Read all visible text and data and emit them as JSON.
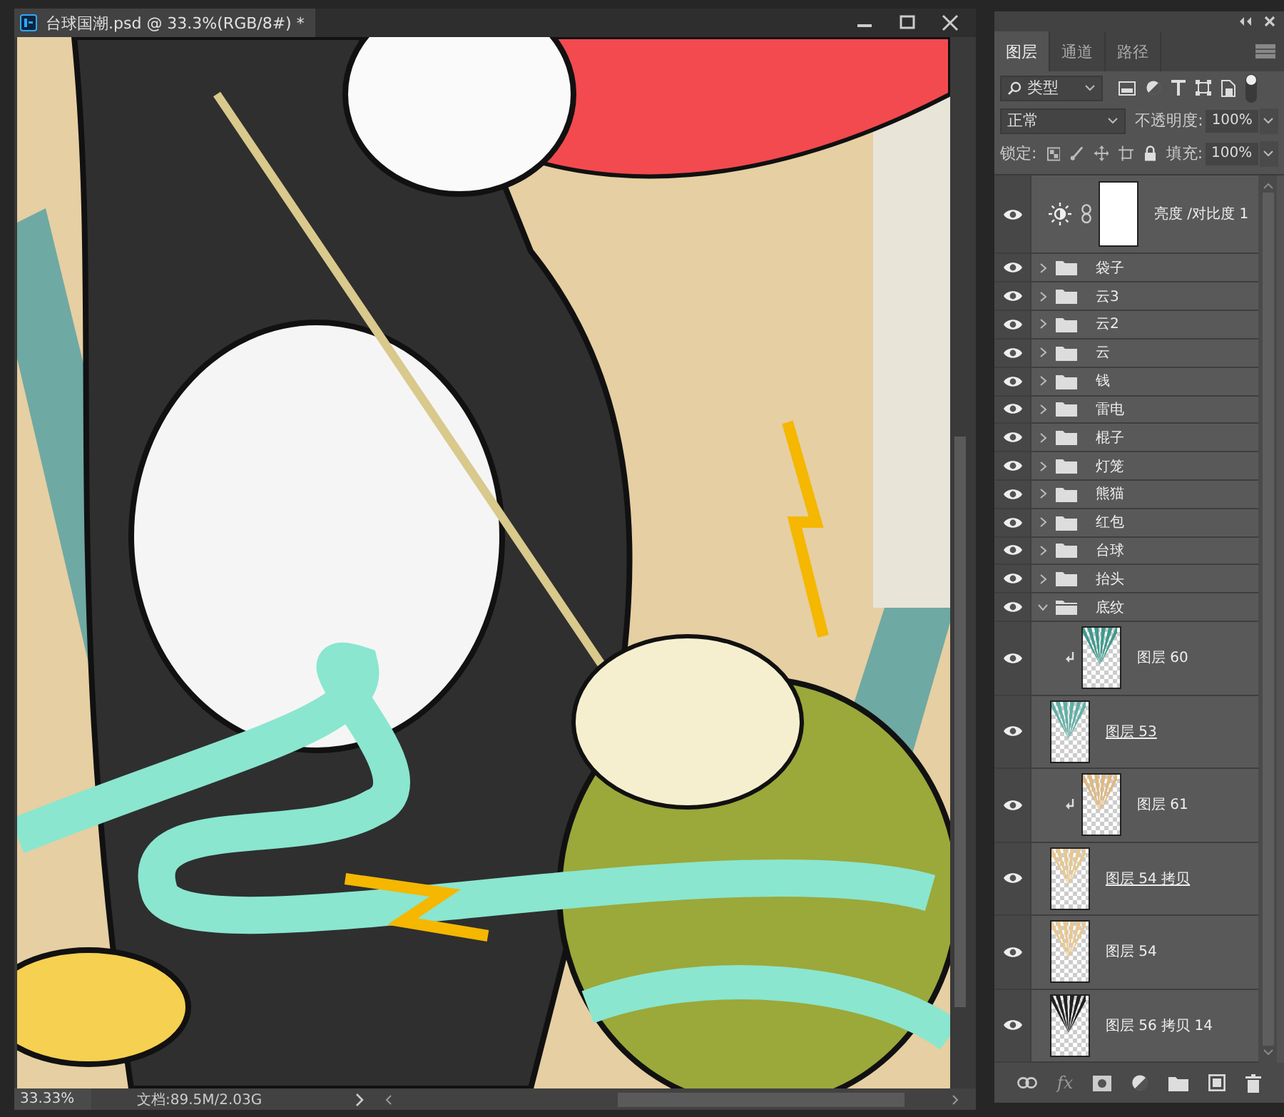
{
  "document": {
    "title": "台球国潮.psd @ 33.3%(RGB/8#) *",
    "zoom": "33.33%",
    "doc_info": "文档:89.5M/2.03G"
  },
  "layers_panel": {
    "tabs": [
      {
        "label": "图层",
        "selected": true
      },
      {
        "label": "通道",
        "selected": false
      },
      {
        "label": "路径",
        "selected": false
      }
    ],
    "filter": {
      "value": "类型"
    },
    "blend_mode": {
      "value": "正常"
    },
    "opacity": {
      "label": "不透明度:",
      "value": "100%"
    },
    "lock_label": "锁定:",
    "fill": {
      "label": "填充:",
      "value": "100%"
    },
    "layers": [
      {
        "kind": "adjustment",
        "name": "亮度 /对比度 1",
        "visible": true
      },
      {
        "kind": "group",
        "name": "袋子",
        "visible": true,
        "expanded": false
      },
      {
        "kind": "group",
        "name": "云3",
        "visible": true,
        "expanded": false
      },
      {
        "kind": "group",
        "name": "云2",
        "visible": true,
        "expanded": false
      },
      {
        "kind": "group",
        "name": "云",
        "visible": true,
        "expanded": false
      },
      {
        "kind": "group",
        "name": "钱",
        "visible": true,
        "expanded": false
      },
      {
        "kind": "group",
        "name": "雷电",
        "visible": true,
        "expanded": false
      },
      {
        "kind": "group",
        "name": "棍子",
        "visible": true,
        "expanded": false
      },
      {
        "kind": "group",
        "name": "灯笼",
        "visible": true,
        "expanded": false
      },
      {
        "kind": "group",
        "name": "熊猫",
        "visible": true,
        "expanded": false
      },
      {
        "kind": "group",
        "name": "红包",
        "visible": true,
        "expanded": false
      },
      {
        "kind": "group",
        "name": "台球",
        "visible": true,
        "expanded": false
      },
      {
        "kind": "group",
        "name": "抬头",
        "visible": true,
        "expanded": false
      },
      {
        "kind": "group",
        "name": "底纹",
        "visible": true,
        "expanded": true,
        "children": [
          {
            "kind": "pixel",
            "name": "图层 60",
            "visible": true,
            "clipped": true,
            "clip_base": false,
            "color": "#3f9a8c"
          },
          {
            "kind": "pixel",
            "name": "图层 53",
            "visible": true,
            "clipped": false,
            "clip_base": true,
            "color": "#5fb0a6"
          },
          {
            "kind": "pixel",
            "name": "图层 61",
            "visible": true,
            "clipped": true,
            "clip_base": false,
            "color": "#e0b880"
          },
          {
            "kind": "pixel",
            "name": "图层 54 拷贝",
            "visible": true,
            "clipped": false,
            "clip_base": true,
            "color": "#e8c890"
          },
          {
            "kind": "pixel",
            "name": "图层 54",
            "visible": true,
            "clipped": false,
            "clip_base": false,
            "color": "#e8c890"
          },
          {
            "kind": "pixel",
            "name": "图层 56 拷贝 14",
            "visible": true,
            "clipped": false,
            "clip_base": false,
            "color": "#222222"
          }
        ]
      }
    ],
    "effects_label": "fx"
  }
}
